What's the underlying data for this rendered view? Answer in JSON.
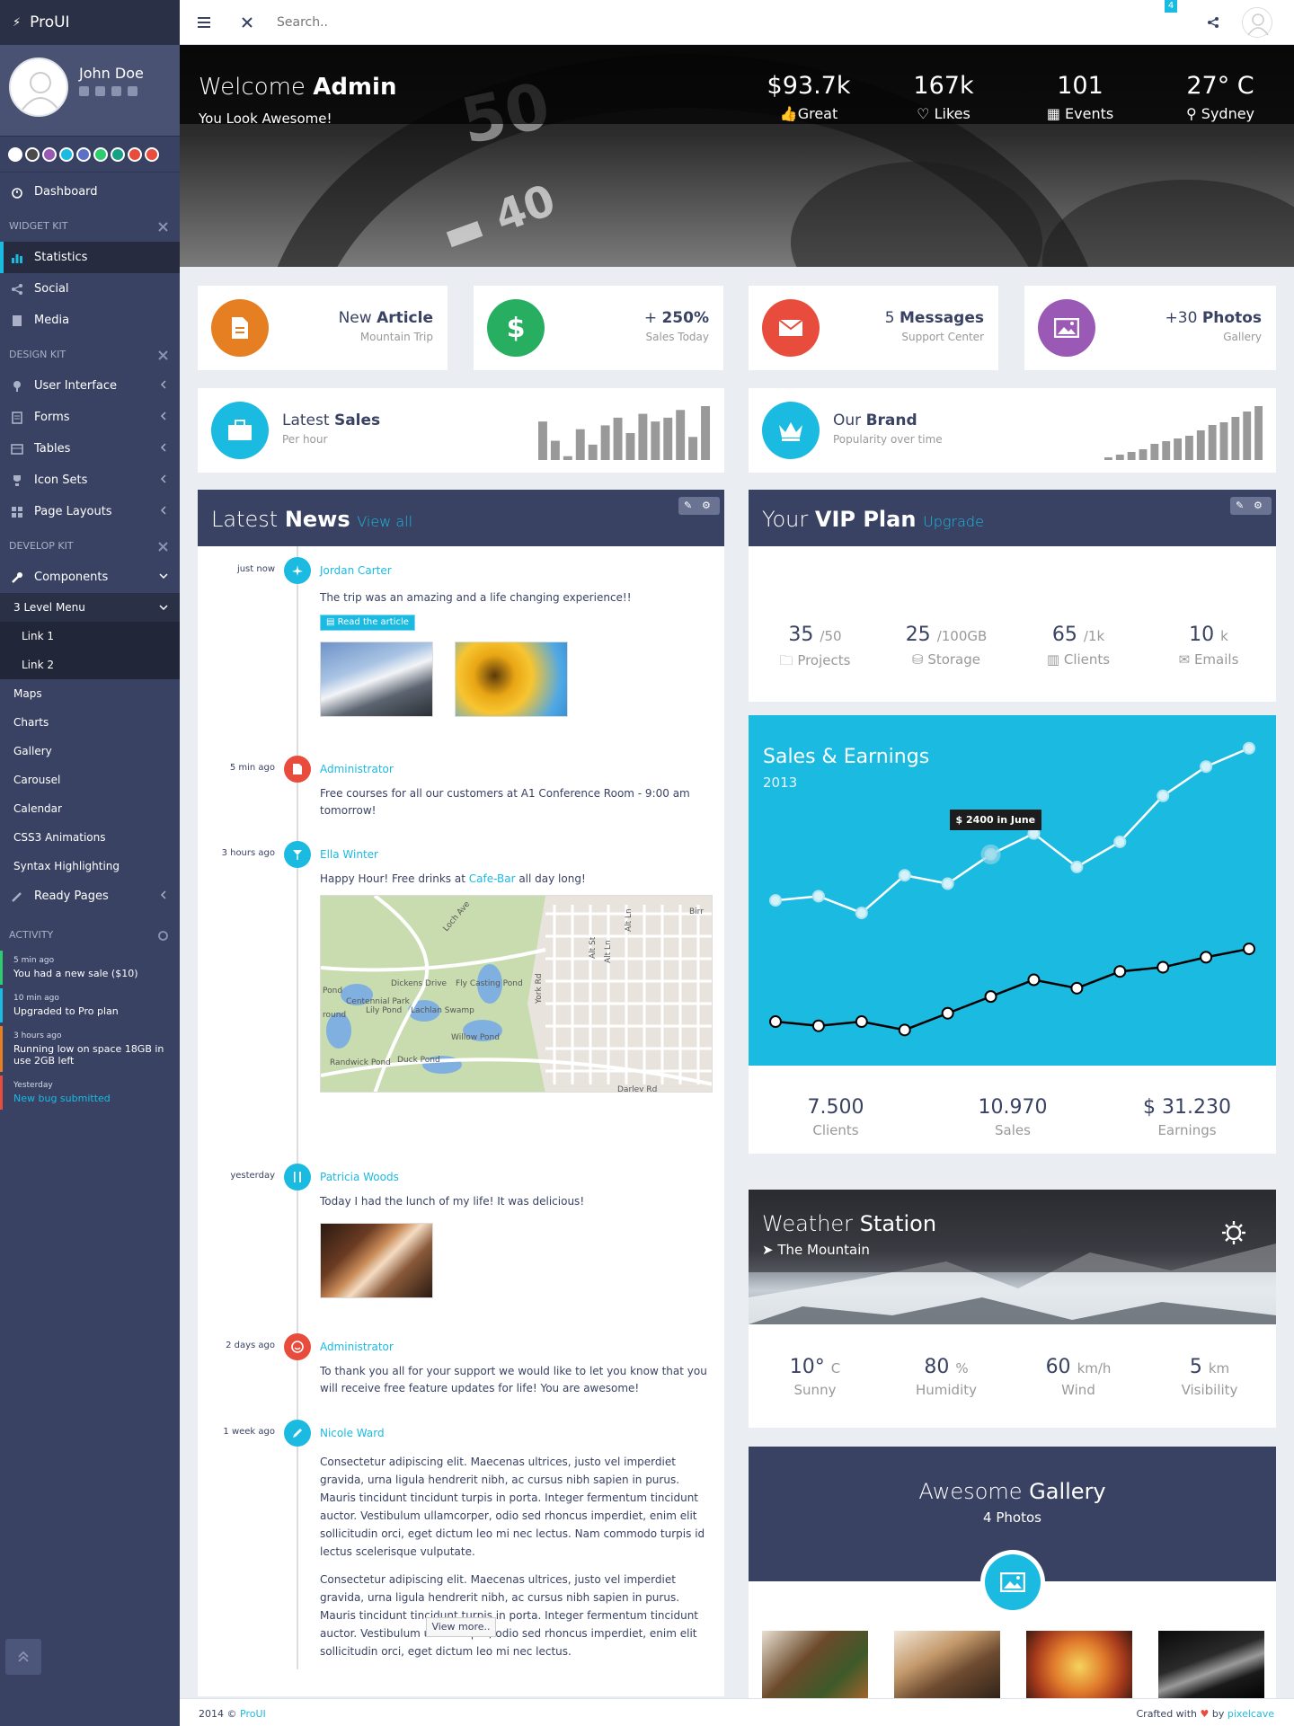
{
  "brand": {
    "name": "ProUI"
  },
  "profile": {
    "name": "John Doe"
  },
  "theme_colors": [
    "#ffffff",
    "#4a4a4a",
    "#9b59b6",
    "#1bbae1",
    "#5b71c8",
    "#2ecc71",
    "#16a085",
    "#e74c3c",
    "#e74c3c"
  ],
  "nav": {
    "dashboard": "Dashboard",
    "widget_kit": "WIDGET KIT",
    "statistics": "Statistics",
    "social": "Social",
    "media": "Media",
    "design_kit": "DESIGN KIT",
    "user_interface": "User Interface",
    "forms": "Forms",
    "tables": "Tables",
    "icon_sets": "Icon Sets",
    "page_layouts": "Page Layouts",
    "develop_kit": "DEVELOP KIT",
    "components": "Components",
    "level_menu": "3 Level Menu",
    "link1": "Link 1",
    "link2": "Link 2",
    "maps": "Maps",
    "charts": "Charts",
    "gallery": "Gallery",
    "carousel": "Carousel",
    "calendar": "Calendar",
    "css3": "CSS3 Animations",
    "syntax": "Syntax Highlighting",
    "ready_pages": "Ready Pages",
    "activity": "ACTIVITY"
  },
  "activity": [
    {
      "time": "5 min ago",
      "text": "You had a new sale ($10)",
      "color": "#2ecc71"
    },
    {
      "time": "10 min ago",
      "text": "Upgraded to Pro plan",
      "color": "#1bbae1"
    },
    {
      "time": "3 hours ago",
      "text": "Running low on space 18GB in use 2GB left",
      "color": "#e67e22"
    },
    {
      "time": "Yesterday",
      "text": "New bug submitted",
      "color": "#e74c3c"
    }
  ],
  "header": {
    "search_placeholder": "Search..",
    "notif_count": "4"
  },
  "hero": {
    "welcome": "Welcome",
    "welcome_name": "Admin",
    "subtitle": "You Look Awesome!",
    "stats": [
      {
        "value": "$93.7k",
        "label": "Great"
      },
      {
        "value": "167k",
        "label": "Likes"
      },
      {
        "value": "101",
        "label": "Events"
      },
      {
        "value": "27° C",
        "label": "Sydney"
      }
    ]
  },
  "tiles": [
    {
      "lead": "New",
      "strong": "Article",
      "sub": "Mountain Trip",
      "color": "#e67e22"
    },
    {
      "lead": "+",
      "strong": "250%",
      "sub": "Sales Today",
      "color": "#27ae60"
    },
    {
      "lead": "5",
      "strong": "Messages",
      "sub": "Support Center",
      "color": "#e74c3c"
    },
    {
      "lead": "+30",
      "strong": "Photos",
      "sub": "Gallery",
      "color": "#9b59b6"
    }
  ],
  "latest_sales": {
    "lead": "Latest",
    "strong": "Sales",
    "sub": "Per hour",
    "bars": [
      10,
      5,
      1,
      8,
      4,
      9,
      11,
      7,
      12,
      10,
      11,
      13,
      6,
      14
    ]
  },
  "our_brand": {
    "lead": "Our",
    "strong": "Brand",
    "sub": "Popularity over time",
    "bars": [
      0.5,
      1,
      1.5,
      2,
      3,
      3.5,
      4,
      4.5,
      5.5,
      6.5,
      7,
      8,
      9,
      10
    ]
  },
  "news": {
    "title": "Latest",
    "title_strong": "News",
    "view_all": "View all",
    "items": [
      {
        "time": "just now",
        "name": "Jordan Carter",
        "text": "The trip was an amazing and a life changing experience!!",
        "button": "Read the article",
        "color": "#1bbae1"
      },
      {
        "time": "5 min ago",
        "name": "Administrator",
        "text": "Free courses for all our customers at A1 Conference Room - 9:00 am tomorrow!",
        "color": "#e74c3c"
      },
      {
        "time": "3 hours ago",
        "name": "Ella Winter",
        "text_before": "Happy Hour! Free drinks at",
        "link": "Cafe-Bar",
        "text_after": "all day long!",
        "color": "#1bbae1"
      },
      {
        "time": "yesterday",
        "name": "Patricia Woods",
        "text": "Today I had the lunch of my life! It was delicious!",
        "color": "#1bbae1"
      },
      {
        "time": "2 days ago",
        "name": "Administrator",
        "text": "To thank you all for your support we would like to let you know that you will receive free feature updates for life! You are awesome!",
        "color": "#e74c3c"
      },
      {
        "time": "1 week ago",
        "name": "Nicole Ward",
        "text": "Consectetur adipiscing elit. Maecenas ultrices, justo vel imperdiet gravida, urna ligula hendrerit nibh, ac cursus nibh sapien in purus. Mauris tincidunt tincidunt turpis in porta. Integer fermentum tincidunt auctor. Vestibulum ullamcorper, odio sed rhoncus imperdiet, enim elit sollicitudin orci, eget dictum leo mi nec lectus. Nam commodo turpis id lectus scelerisque vulputate.",
        "text2": "Consectetur adipiscing elit. Maecenas ultrices, justo vel imperdiet gravida, urna ligula hendrerit nibh, ac cursus nibh sapien in purus. Mauris tincidunt tincidunt turpis in porta. Integer fermentum tincidunt auctor. Vestibulum ullamcorper, odio sed rhoncus imperdiet, enim elit sollicitudin orci, eget dictum leo mi nec lectus.",
        "color": "#1bbae1"
      }
    ],
    "view_more": "View more..",
    "map_labels": [
      "Loch Ave",
      "Dickens Drive",
      "Centennial Park",
      "Lily Pond",
      "Lachlan Swamp",
      "Fly Casting Pond",
      "Willow Pond",
      "Randwick Pond",
      "Duck Pond",
      "York Rd",
      "Darley Rd",
      "Pond",
      "round",
      "Birr",
      "Alt Ln",
      "Alt St",
      "Alt Ln"
    ]
  },
  "vip": {
    "title": "Your",
    "title_strong": "VIP Plan",
    "upgrade": "Upgrade",
    "stats": [
      {
        "value": "35",
        "unit": "/50",
        "label": "Projects"
      },
      {
        "value": "25",
        "unit": "/100GB",
        "label": "Storage"
      },
      {
        "value": "65",
        "unit": "/1k",
        "label": "Clients"
      },
      {
        "value": "10",
        "unit": "k",
        "label": "Emails"
      }
    ]
  },
  "sales_card": {
    "title": "Sales & Earnings",
    "year": "2013",
    "tooltip": "$ 2400 in June",
    "stats": [
      {
        "value": "7.500",
        "label": "Clients"
      },
      {
        "value": "10.970",
        "label": "Sales"
      },
      {
        "value": "$ 31.230",
        "label": "Earnings"
      }
    ]
  },
  "chart_data": {
    "type": "line",
    "title": "Sales & Earnings",
    "subtitle": "2013",
    "x": [
      1,
      2,
      3,
      4,
      5,
      6,
      7,
      8,
      9,
      10,
      11,
      12
    ],
    "series": [
      {
        "values": [
          1600,
          1650,
          1450,
          1900,
          1800,
          2150,
          2400,
          2000,
          2300,
          2850,
          3200,
          3420
        ],
        "color": "#d4f2fa"
      },
      {
        "values": [
          150,
          100,
          150,
          50,
          250,
          450,
          650,
          550,
          750,
          800,
          920,
          1020
        ],
        "color": "#ffffff"
      }
    ],
    "ylim": [
      0,
      3600
    ],
    "grid": false,
    "annotations": [
      {
        "x": 6,
        "text": "$ 2400 in June"
      }
    ]
  },
  "weather": {
    "title": "Weather",
    "title_strong": "Station",
    "location": "The Mountain",
    "stats": [
      {
        "value": "10°",
        "unit": "C",
        "label": "Sunny"
      },
      {
        "value": "80",
        "unit": "%",
        "label": "Humidity"
      },
      {
        "value": "60",
        "unit": "km/h",
        "label": "Wind"
      },
      {
        "value": "5",
        "unit": "km",
        "label": "Visibility"
      }
    ]
  },
  "gallery": {
    "title": "Awesome",
    "title_strong": "Gallery",
    "count": "4 Photos"
  },
  "footer": {
    "year": "2014 ©",
    "brand": "ProUI",
    "crafted": "Crafted with",
    "by": "by",
    "author": "pixelcave"
  }
}
